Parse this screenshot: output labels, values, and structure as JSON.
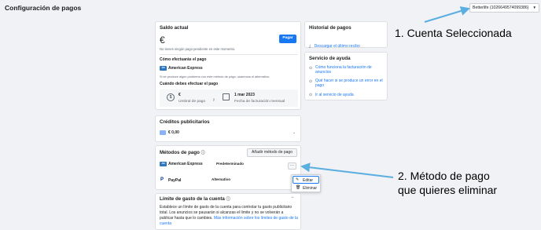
{
  "page": {
    "title": "Configuración de pagos"
  },
  "account_selector": {
    "value": "Betterlife (1026649574099386)"
  },
  "balance": {
    "heading": "Saldo actual",
    "amount": "€",
    "pay_button": "Pagar",
    "no_pending": "No tienes ningún pago pendiente en este momento.",
    "how_heading": "Cómo efectuarás el pago",
    "method": "American Express",
    "problem_note": "Si se produce algún problema con este método de pago, usaremos el alternativo.",
    "when_heading": "Cuándo debes efectuar el pago",
    "threshold_value": "€",
    "threshold_label": "Umbral de pago",
    "or": "y",
    "billing_date": "1 mar 2023",
    "billing_label": "Fecha de facturación mensual"
  },
  "credits": {
    "heading": "Créditos publicitarios",
    "amount": "€ 0,00"
  },
  "payment_methods": {
    "heading": "Métodos de pago",
    "add_button": "Añadir método de pago",
    "items": [
      {
        "name": "American Express",
        "status": "Predeterminado"
      },
      {
        "name": "PayPal",
        "status": "Alternativo"
      }
    ],
    "more_label": "···",
    "menu": {
      "edit": "Editar",
      "delete": "Eliminar"
    }
  },
  "spend_limit": {
    "heading": "Límite de gasto de la cuenta",
    "body": "Establece un límite de gasto de la cuenta para controlar tu gasto publicitario total. Los anuncios se pausarán si alcanzas el límite y no se volverán a publicar hasta que lo cambies.",
    "link": "Más información sobre los límites de gasto de la cuenta"
  },
  "history": {
    "heading": "Historial de pagos",
    "link": "Descargar el último recibo"
  },
  "help": {
    "heading": "Servicio de ayuda",
    "links": [
      "Cómo funciona la facturación de anuncios",
      "Qué hacer si se produce un error en el pago",
      "Ir al servicio de ayuda"
    ]
  },
  "annotations": {
    "one": "1. Cuenta Seleccionada",
    "two_line1": "2. Método de pago",
    "two_line2": "que quieres eliminar",
    "arrow_color": "#5aaee0"
  }
}
